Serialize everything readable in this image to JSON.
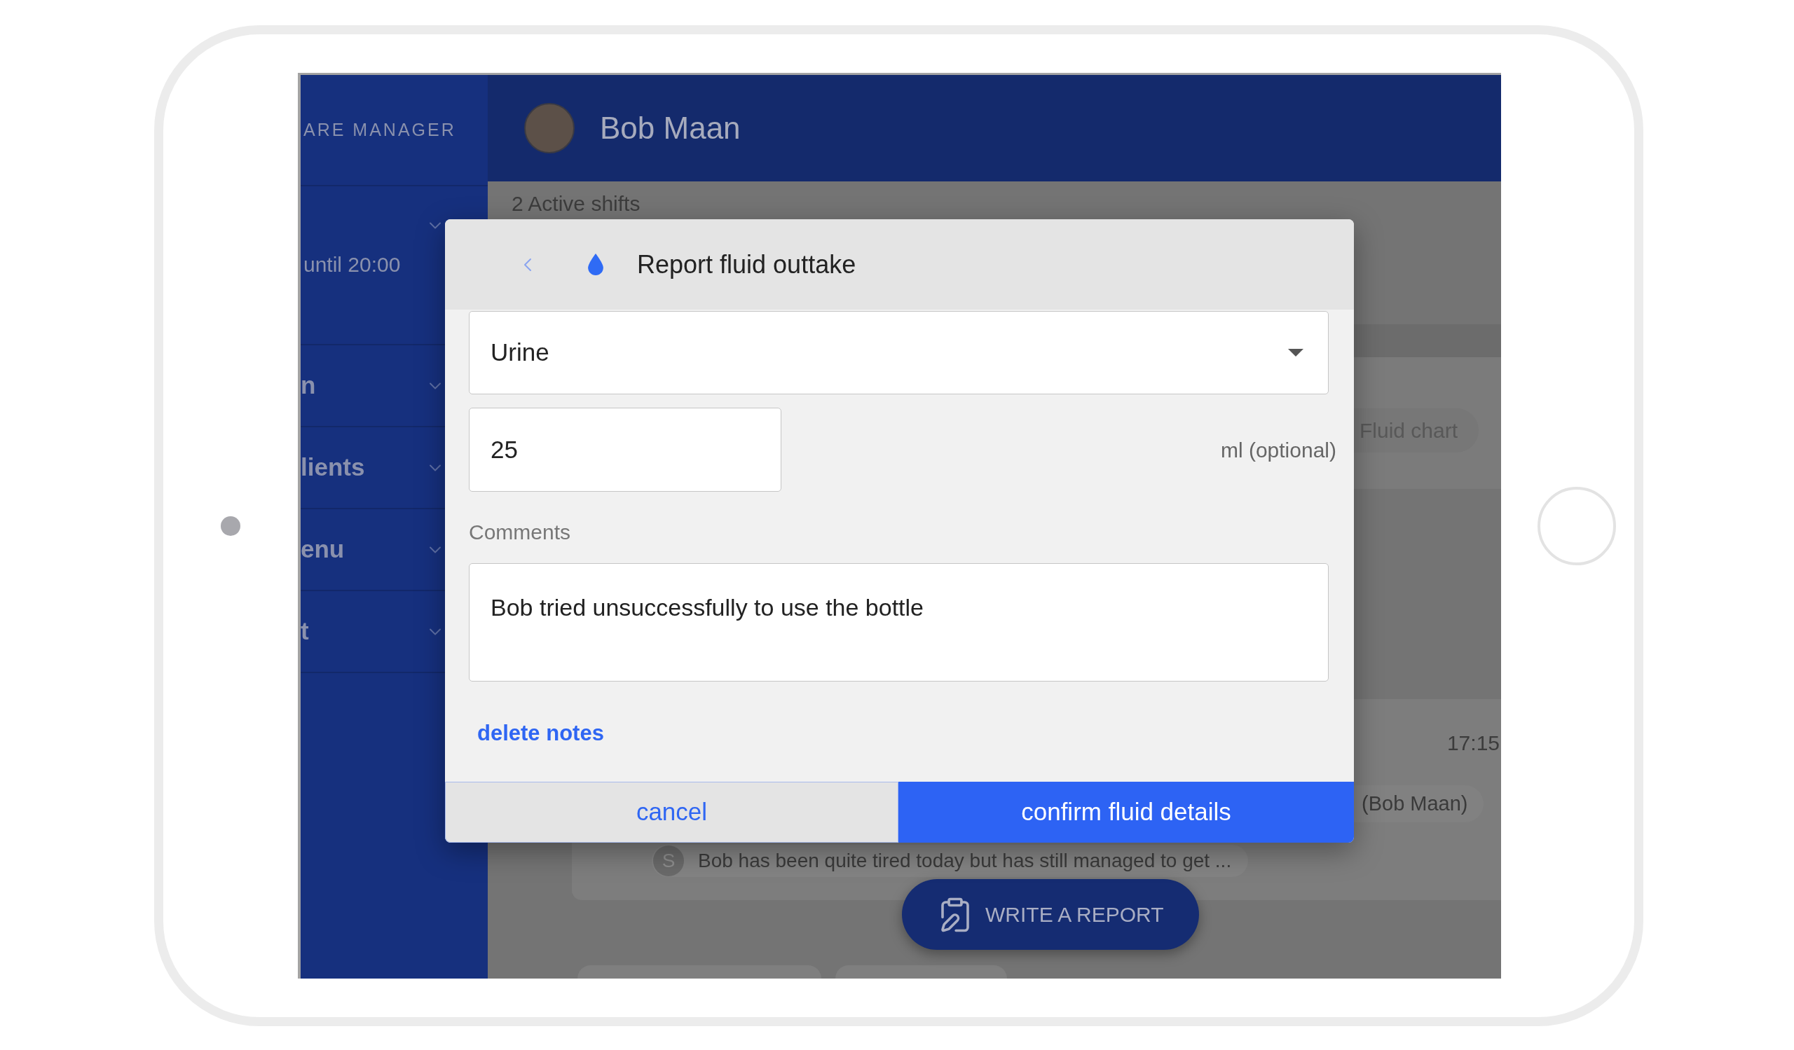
{
  "sidebar": {
    "brand": "ARE MANAGER",
    "items": [
      {
        "kind": "shift",
        "subtitle": "until 20:00"
      },
      {
        "kind": "menu",
        "label": "n"
      },
      {
        "kind": "menu",
        "label": "lients"
      },
      {
        "kind": "menu",
        "label": "enu"
      },
      {
        "kind": "menu",
        "label": "t"
      }
    ]
  },
  "header": {
    "name": "Bob Maan"
  },
  "content": {
    "shifts_heading": "2 Active shifts",
    "fluid_chart_button": "Fluid chart",
    "entry": {
      "time": "17:15",
      "author": "(Bob Maan)",
      "note": {
        "initial": "S",
        "text": "Bob has been quite tired today but has still managed to get ..."
      }
    },
    "write_report_button": "WRITE A REPORT"
  },
  "dialog": {
    "title": "Report fluid outtake",
    "type_select": {
      "value": "Urine"
    },
    "amount": {
      "value": "25",
      "unit": "ml (optional)"
    },
    "comments": {
      "label": "Comments",
      "value": "Bob tried unsuccessfully to use the bottle"
    },
    "delete_link": "delete notes",
    "buttons": [
      {
        "label": "cancel",
        "kind": "secondary"
      },
      {
        "label": "confirm fluid details",
        "kind": "primary"
      }
    ]
  }
}
